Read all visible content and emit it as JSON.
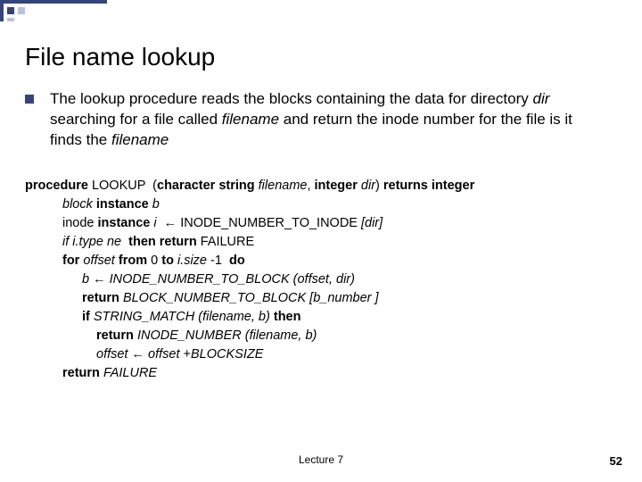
{
  "title": "File name lookup",
  "bullet": {
    "html": "The lookup procedure reads the blocks containing the data for directory <i>dir</i> searching for a file called <i>filename</i> and return the inode number for the file is it finds the <i>filename</i>"
  },
  "code": {
    "l0": "<b>procedure</b> LOOKUP  (<b>character string</b> <i>filename</i>, <b>integer</b> <i>dir</i>) <b>returns integer</b>",
    "l1": "<i>block</i> <b>instance</b> <i>b</i>",
    "l2": "inode <b>instance</b> <i>i</i>  ← INODE_NUMBER_TO_INODE <i>[dir]</i>",
    "l3": "<i>if i.type ne</i>  <b>then return</b> FAILURE",
    "l4": "<b>for</b> <i>offset</i> <b>from</b> 0 <b>to</b> <i>i.size</i> -1  <b>do</b>",
    "l5": "<i>b</i> ← <i>INODE_NUMBER_TO_BLOCK (offset, dir)</i>",
    "l6": "<b>return</b> <i>BLOCK_NUMBER_TO_BLOCK [b_number ]</i>",
    "l7": "<b>if</b> <i>STRING_MATCH (filename, b)</i> <b>then</b>",
    "l8": "<b>return</b> <i>INODE_NUMBER (filename, b)</i>",
    "l9": "<i>offset</i> ← <i>offset</i> +<i>BLOCKSIZE</i>",
    "l10": "<b>return</b> <i>FAILURE</i>"
  },
  "footer": {
    "center": "Lecture 7",
    "right": "52"
  }
}
